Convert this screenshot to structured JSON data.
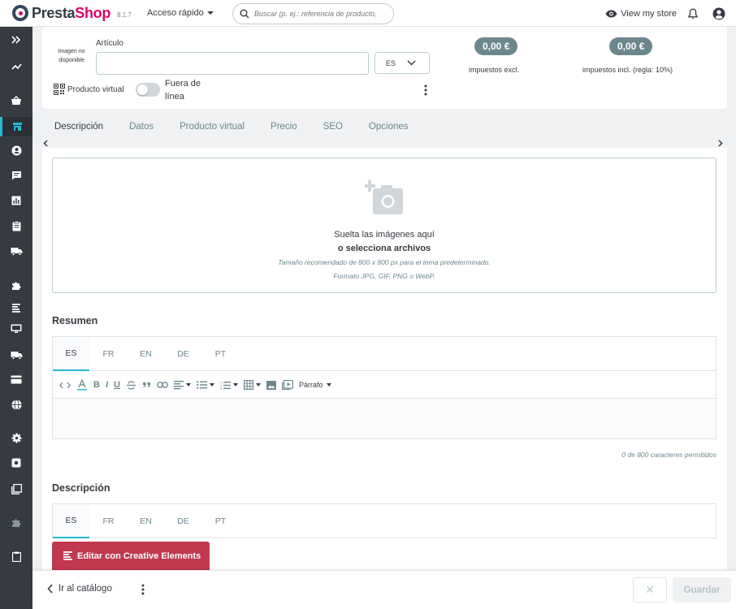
{
  "app": {
    "brand_presta": "Presta",
    "brand_shop": "Shop",
    "version": "8.1.7",
    "quick_access": "Acceso rápido",
    "search_placeholder": "Buscar (p. ej.: referencia de producto,",
    "view_store": "View my store"
  },
  "sidebar": {
    "icons": [
      "expand-icon",
      "stats-trend-icon",
      "basket-icon",
      "store-icon",
      "customer-icon",
      "messages-icon",
      "bar-chart-icon",
      "clipboard-icon",
      "truck-icon",
      "puzzle-icon",
      "list-icon",
      "monitor-icon",
      "shipping-icon",
      "card-icon",
      "globe-icon",
      "gear-icon",
      "settings-box-icon",
      "pages-icon",
      "puzzle-grey-icon",
      "clipboard-bottom-icon"
    ]
  },
  "header": {
    "image_unavailable": "Imagen no disponible",
    "article_label": "Artículo",
    "article_value": "",
    "lang_selected": "ES",
    "virtual_product": "Producto virtual",
    "offline_label": "Fuera de línea",
    "price_excl": "0,00 €",
    "price_excl_caption": "impuestos excl.",
    "price_incl": "0,00 €",
    "price_incl_caption": "impuestos incl. (regla: 10%)"
  },
  "tabs": [
    "Descripción",
    "Datos",
    "Producto virtual",
    "Precio",
    "SEO",
    "Opciones"
  ],
  "dropzone": {
    "line1": "Suelta las imágenes aquí",
    "line2": "o selecciona archivos",
    "line3": "Tamaño recomendado de 800 x 800 px para el tema predeterminado.",
    "line4": "Formato JPG, GIF, PNG o WebP."
  },
  "summary": {
    "title": "Resumen",
    "langs": [
      "ES",
      "FR",
      "EN",
      "DE",
      "PT"
    ],
    "paragraph_label": "Párrafo",
    "char_count": "0 de 800 caracteres permitidos"
  },
  "description": {
    "title": "Descripción",
    "langs": [
      "ES",
      "FR",
      "EN",
      "DE",
      "PT"
    ],
    "creative_button": "Editar con Creative Elements"
  },
  "footer": {
    "back_label": "Ir al catálogo",
    "close_label": "✕",
    "save_label": "Guardar"
  },
  "colors": {
    "accent": "#25b9d7",
    "sidebar_bg": "#363a41",
    "price_badge": "#6c868e",
    "creative_button": "#c0394f",
    "brand_pink": "#df0067"
  }
}
